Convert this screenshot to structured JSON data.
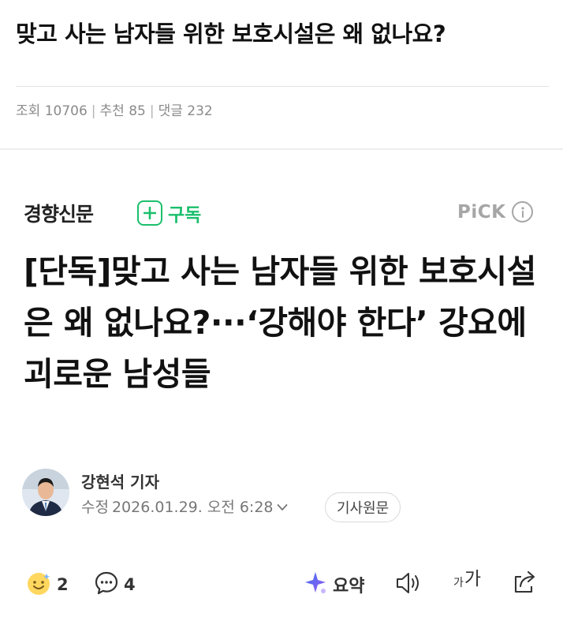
{
  "post": {
    "title": "맞고 사는 남자들 위한 보호시설은 왜 없나요?",
    "views_label": "조회",
    "views": "10706",
    "recommend_label": "추천",
    "recommend": "85",
    "comments_label": "댓글",
    "comments": "232",
    "separator": "|"
  },
  "article": {
    "press": "경향신문",
    "subscribe_label": "구독",
    "pick_label": "PiCK",
    "headline": "[단독]맞고 사는 남자들 위한 보호시설은 왜 없나요?···‘강해야 한다’ 강요에 괴로운 남성들",
    "reporter": "강현석 기자",
    "edited_label": "수정",
    "edited_datetime": "2026.01.29. 오전 6:28",
    "original_button": "기사원문"
  },
  "actions": {
    "reaction_count": "2",
    "comment_count": "4",
    "summary_label": "요약",
    "font_small": "가",
    "font_large": "가"
  },
  "colors": {
    "accent_green": "#1bbf6c",
    "muted_gray": "#a6a6a6",
    "text": "#111111",
    "summary_blue": "#3f6ff0",
    "summary_purple": "#9a5cf0"
  },
  "icons": [
    "plus-icon",
    "info-icon",
    "chevron-down-icon",
    "smile-emoji-icon",
    "comment-bubble-icon",
    "summary-sparkle-icon",
    "speaker-icon",
    "font-size-icon",
    "share-icon"
  ]
}
